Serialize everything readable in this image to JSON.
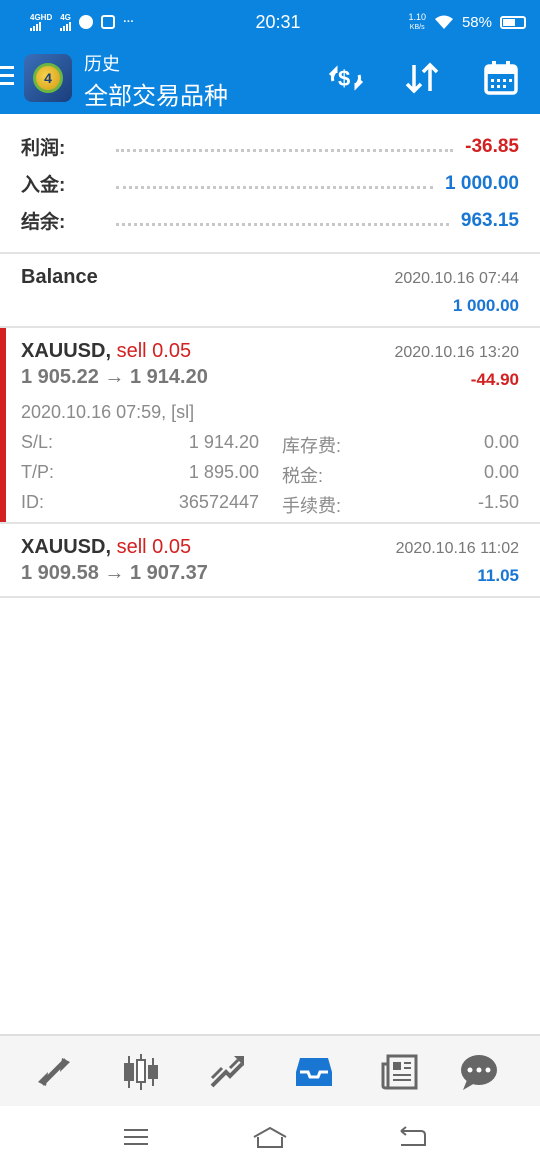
{
  "status_bar": {
    "network1": "4G",
    "network1_sub": "HD",
    "network2": "4G",
    "more": "···",
    "time": "20:31",
    "speed": "1.10",
    "speed_unit": "KB/s",
    "battery": "58%"
  },
  "app_bar": {
    "subtitle": "历史",
    "title": "全部交易品种",
    "logo_text": "4"
  },
  "summary": [
    {
      "label": "利润:",
      "value": "-36.85",
      "color": "#d32121"
    },
    {
      "label": "入金:",
      "value": "1 000.00",
      "color": "#1976d2"
    },
    {
      "label": "结余:",
      "value": "963.15",
      "color": "#1976d2"
    }
  ],
  "balance": {
    "title": "Balance",
    "time": "2020.10.16 07:44",
    "amount": "1 000.00"
  },
  "deals": [
    {
      "symbol": "XAUUSD,",
      "action": "sell 0.05",
      "time": "2020.10.16 13:20",
      "prices": "1 905.22 → 1 914.20",
      "profit": "-44.90",
      "open_time": "2020.10.16 07:59, [sl]",
      "sl_label": "S/L:",
      "sl": "1 914.20",
      "tp_label": "T/P:",
      "tp": "1 895.00",
      "id_label": "ID:",
      "id": "36572447",
      "swap_label": "库存费:",
      "swap": "0.00",
      "tax_label": "税金:",
      "tax": "0.00",
      "fee_label": "手续费:",
      "fee": "-1.50"
    },
    {
      "symbol": "XAUUSD,",
      "action": "sell 0.05",
      "time": "2020.10.16 11:02",
      "prices": "1 909.58 → 1 907.37",
      "profit": "11.05"
    }
  ],
  "bottom_nav": [
    "quotes-icon",
    "chart-icon",
    "trade-icon",
    "history-icon",
    "news-icon",
    "chat-icon"
  ],
  "colors": {
    "accent": "#0b84e0",
    "loss": "#d32121",
    "profit": "#1976d2"
  }
}
